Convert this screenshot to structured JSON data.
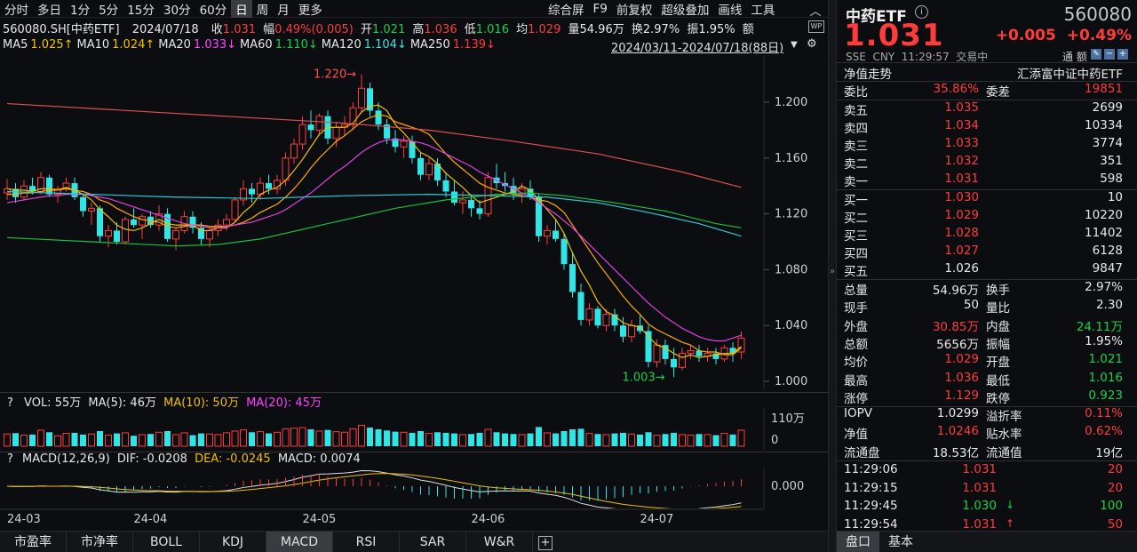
{
  "toolbar": {
    "left": [
      "分时",
      "多日",
      "1分",
      "5分",
      "15分",
      "30分",
      "60分",
      "日",
      "周",
      "月",
      "更多"
    ],
    "selected": "日",
    "right": [
      "综合屏",
      "F9",
      "前复权",
      "超级叠加",
      "画线",
      "工具"
    ],
    "collapse_icon": "chevron-up-icon"
  },
  "info": {
    "symbol": "560080.SH[中药ETF]",
    "date": "2024/07/18",
    "close_label": "收",
    "close": "1.031",
    "chg_label": "幅",
    "chg": "0.49%(0.005)",
    "open_label": "开",
    "open": "1.021",
    "high_label": "高",
    "high": "1.036",
    "low_label": "低",
    "low": "1.016",
    "avg_label": "均",
    "avg": "1.029",
    "vol_label": "量",
    "vol": "54.96万",
    "turn_label": "换",
    "turn": "2.97%",
    "amp_label": "振",
    "amp": "1.95%",
    "amt_label": "额"
  },
  "ma": [
    {
      "label": "MA5",
      "value": "1.025↑",
      "color": "#f0c000"
    },
    {
      "label": "MA10",
      "value": "1.024↑",
      "color": "#f0c000"
    },
    {
      "label": "MA20",
      "value": "1.033↓",
      "color": "#ff44ff"
    },
    {
      "label": "MA60",
      "value": "1.110↓",
      "color": "#16d24a"
    },
    {
      "label": "MA120",
      "value": "1.104↓",
      "color": "#44e0e0"
    },
    {
      "label": "MA250",
      "value": "1.139↓",
      "color": "#ff3b3b"
    }
  ],
  "range_label": "2024/03/11-2024/07/18(88日)",
  "colors": {
    "up": "#ff3b3b",
    "down": "#2ee6e6",
    "ma5": "#f0c000",
    "ma10": "#ffaa00",
    "ma20": "#e040e0",
    "ma60": "#16c040",
    "ma120": "#2ec8d8",
    "ma250": "#e05050"
  },
  "chart_data": {
    "type": "candlestick",
    "price_axis": {
      "ticks": [
        1.0,
        1.04,
        1.08,
        1.12,
        1.16,
        1.2
      ],
      "labels": [
        "1.000",
        "1.040",
        "1.080",
        "1.120",
        "1.160",
        "1.200"
      ]
    },
    "x_ticks": [
      "24-03",
      "24-04",
      "24-05",
      "24-06",
      "24-07"
    ],
    "annotations": {
      "high": "1.220",
      "low": "1.003"
    },
    "ohlc": [
      [
        1.135,
        1.145,
        1.13,
        1.138
      ],
      [
        1.138,
        1.142,
        1.128,
        1.132
      ],
      [
        1.132,
        1.144,
        1.13,
        1.14
      ],
      [
        1.14,
        1.146,
        1.134,
        1.136
      ],
      [
        1.136,
        1.15,
        1.134,
        1.146
      ],
      [
        1.146,
        1.148,
        1.132,
        1.134
      ],
      [
        1.134,
        1.14,
        1.128,
        1.138
      ],
      [
        1.138,
        1.146,
        1.136,
        1.142
      ],
      [
        1.142,
        1.146,
        1.13,
        1.132
      ],
      [
        1.132,
        1.134,
        1.118,
        1.122
      ],
      [
        1.122,
        1.128,
        1.112,
        1.124
      ],
      [
        1.124,
        1.126,
        1.1,
        1.104
      ],
      [
        1.104,
        1.112,
        1.096,
        1.108
      ],
      [
        1.108,
        1.114,
        1.098,
        1.1
      ],
      [
        1.1,
        1.118,
        1.098,
        1.116
      ],
      [
        1.116,
        1.124,
        1.11,
        1.112
      ],
      [
        1.112,
        1.12,
        1.102,
        1.118
      ],
      [
        1.118,
        1.122,
        1.11,
        1.112
      ],
      [
        1.112,
        1.126,
        1.108,
        1.12
      ],
      [
        1.12,
        1.124,
        1.1,
        1.102
      ],
      [
        1.102,
        1.11,
        1.094,
        1.108
      ],
      [
        1.108,
        1.122,
        1.106,
        1.118
      ],
      [
        1.118,
        1.122,
        1.106,
        1.11
      ],
      [
        1.11,
        1.114,
        1.098,
        1.102
      ],
      [
        1.102,
        1.11,
        1.096,
        1.108
      ],
      [
        1.108,
        1.116,
        1.104,
        1.112
      ],
      [
        1.112,
        1.12,
        1.108,
        1.116
      ],
      [
        1.116,
        1.132,
        1.114,
        1.13
      ],
      [
        1.13,
        1.144,
        1.126,
        1.138
      ],
      [
        1.138,
        1.142,
        1.128,
        1.134
      ],
      [
        1.134,
        1.146,
        1.13,
        1.142
      ],
      [
        1.142,
        1.148,
        1.134,
        1.138
      ],
      [
        1.138,
        1.148,
        1.134,
        1.144
      ],
      [
        1.144,
        1.164,
        1.14,
        1.16
      ],
      [
        1.16,
        1.174,
        1.156,
        1.17
      ],
      [
        1.17,
        1.19,
        1.166,
        1.184
      ],
      [
        1.184,
        1.194,
        1.174,
        1.18
      ],
      [
        1.18,
        1.192,
        1.176,
        1.19
      ],
      [
        1.19,
        1.194,
        1.17,
        1.174
      ],
      [
        1.174,
        1.186,
        1.168,
        1.182
      ],
      [
        1.182,
        1.19,
        1.176,
        1.184
      ],
      [
        1.184,
        1.2,
        1.18,
        1.196
      ],
      [
        1.196,
        1.22,
        1.192,
        1.21
      ],
      [
        1.21,
        1.214,
        1.19,
        1.194
      ],
      [
        1.194,
        1.2,
        1.18,
        1.184
      ],
      [
        1.184,
        1.188,
        1.17,
        1.174
      ],
      [
        1.174,
        1.18,
        1.164,
        1.168
      ],
      [
        1.168,
        1.176,
        1.16,
        1.172
      ],
      [
        1.172,
        1.176,
        1.156,
        1.16
      ],
      [
        1.16,
        1.164,
        1.144,
        1.148
      ],
      [
        1.148,
        1.16,
        1.144,
        1.156
      ],
      [
        1.156,
        1.16,
        1.14,
        1.144
      ],
      [
        1.144,
        1.15,
        1.132,
        1.136
      ],
      [
        1.136,
        1.144,
        1.126,
        1.128
      ],
      [
        1.128,
        1.136,
        1.12,
        1.13
      ],
      [
        1.13,
        1.134,
        1.118,
        1.124
      ],
      [
        1.124,
        1.13,
        1.116,
        1.12
      ],
      [
        1.12,
        1.15,
        1.118,
        1.146
      ],
      [
        1.146,
        1.156,
        1.138,
        1.142
      ],
      [
        1.142,
        1.15,
        1.136,
        1.14
      ],
      [
        1.14,
        1.146,
        1.13,
        1.134
      ],
      [
        1.134,
        1.142,
        1.128,
        1.138
      ],
      [
        1.138,
        1.144,
        1.13,
        1.132
      ],
      [
        1.132,
        1.134,
        1.1,
        1.104
      ],
      [
        1.104,
        1.112,
        1.098,
        1.108
      ],
      [
        1.108,
        1.116,
        1.1,
        1.102
      ],
      [
        1.102,
        1.106,
        1.08,
        1.084
      ],
      [
        1.084,
        1.092,
        1.06,
        1.064
      ],
      [
        1.064,
        1.07,
        1.04,
        1.044
      ],
      [
        1.044,
        1.056,
        1.04,
        1.052
      ],
      [
        1.052,
        1.054,
        1.038,
        1.04
      ],
      [
        1.04,
        1.052,
        1.036,
        1.048
      ],
      [
        1.048,
        1.052,
        1.036,
        1.04
      ],
      [
        1.04,
        1.046,
        1.028,
        1.032
      ],
      [
        1.032,
        1.044,
        1.028,
        1.04
      ],
      [
        1.04,
        1.048,
        1.034,
        1.036
      ],
      [
        1.036,
        1.04,
        1.01,
        1.014
      ],
      [
        1.014,
        1.03,
        1.01,
        1.026
      ],
      [
        1.026,
        1.03,
        1.012,
        1.016
      ],
      [
        1.016,
        1.024,
        1.003,
        1.01
      ],
      [
        1.01,
        1.024,
        1.008,
        1.02
      ],
      [
        1.02,
        1.026,
        1.016,
        1.022
      ],
      [
        1.022,
        1.026,
        1.014,
        1.018
      ],
      [
        1.018,
        1.024,
        1.014,
        1.02
      ],
      [
        1.02,
        1.024,
        1.012,
        1.016
      ],
      [
        1.016,
        1.026,
        1.014,
        1.024
      ],
      [
        1.024,
        1.028,
        1.014,
        1.02
      ],
      [
        1.021,
        1.036,
        1.016,
        1.031
      ]
    ],
    "ma_series": {
      "ma5": [
        1.138,
        1.137,
        1.137,
        1.136,
        1.138,
        1.138,
        1.137,
        1.139,
        1.137,
        1.134,
        1.13,
        1.123,
        1.118,
        1.112,
        1.109,
        1.108,
        1.11,
        1.113,
        1.116,
        1.113,
        1.112,
        1.112,
        1.112,
        1.108,
        1.108,
        1.11,
        1.11,
        1.114,
        1.121,
        1.126,
        1.134,
        1.137,
        1.139,
        1.144,
        1.151,
        1.159,
        1.168,
        1.177,
        1.182,
        1.182,
        1.182,
        1.185,
        1.193,
        1.197,
        1.198,
        1.194,
        1.184,
        1.178,
        1.171,
        1.164,
        1.161,
        1.156,
        1.149,
        1.144,
        1.139,
        1.133,
        1.128,
        1.13,
        1.132,
        1.134,
        1.136,
        1.14,
        1.137,
        1.13,
        1.123,
        1.116,
        1.106,
        1.092,
        1.079,
        1.069,
        1.057,
        1.05,
        1.047,
        1.042,
        1.04,
        1.039,
        1.032,
        1.026,
        1.024,
        1.02,
        1.017,
        1.019,
        1.017,
        1.018,
        1.019,
        1.02,
        1.02,
        1.025
      ],
      "ma10": [
        1.134,
        1.134,
        1.135,
        1.135,
        1.136,
        1.137,
        1.137,
        1.138,
        1.137,
        1.136,
        1.134,
        1.13,
        1.128,
        1.124,
        1.121,
        1.118,
        1.116,
        1.115,
        1.114,
        1.111,
        1.11,
        1.111,
        1.112,
        1.112,
        1.111,
        1.111,
        1.111,
        1.112,
        1.114,
        1.117,
        1.121,
        1.124,
        1.127,
        1.132,
        1.138,
        1.145,
        1.153,
        1.16,
        1.166,
        1.172,
        1.176,
        1.181,
        1.186,
        1.189,
        1.191,
        1.19,
        1.186,
        1.184,
        1.182,
        1.18,
        1.177,
        1.17,
        1.163,
        1.157,
        1.152,
        1.147,
        1.142,
        1.139,
        1.137,
        1.135,
        1.134,
        1.133,
        1.132,
        1.13,
        1.129,
        1.126,
        1.121,
        1.112,
        1.103,
        1.094,
        1.085,
        1.077,
        1.069,
        1.061,
        1.054,
        1.048,
        1.041,
        1.037,
        1.034,
        1.031,
        1.028,
        1.026,
        1.022,
        1.021,
        1.021,
        1.019,
        1.019,
        1.024
      ],
      "ma20": [
        1.128,
        1.129,
        1.13,
        1.131,
        1.132,
        1.133,
        1.133,
        1.134,
        1.134,
        1.134,
        1.133,
        1.132,
        1.131,
        1.129,
        1.127,
        1.125,
        1.123,
        1.121,
        1.119,
        1.117,
        1.115,
        1.113,
        1.112,
        1.111,
        1.11,
        1.11,
        1.111,
        1.112,
        1.113,
        1.114,
        1.116,
        1.118,
        1.12,
        1.123,
        1.127,
        1.131,
        1.135,
        1.14,
        1.145,
        1.15,
        1.154,
        1.159,
        1.164,
        1.168,
        1.171,
        1.173,
        1.173,
        1.173,
        1.172,
        1.171,
        1.169,
        1.166,
        1.163,
        1.16,
        1.157,
        1.154,
        1.15,
        1.147,
        1.144,
        1.141,
        1.138,
        1.135,
        1.132,
        1.128,
        1.124,
        1.12,
        1.115,
        1.11,
        1.104,
        1.098,
        1.092,
        1.086,
        1.08,
        1.074,
        1.068,
        1.062,
        1.056,
        1.051,
        1.046,
        1.042,
        1.038,
        1.035,
        1.032,
        1.03,
        1.029,
        1.029,
        1.031,
        1.033
      ]
    },
    "ma_long": {
      "ma60": [
        [
          0,
          1.103
        ],
        [
          10,
          1.1
        ],
        [
          20,
          1.097
        ],
        [
          25,
          1.098
        ],
        [
          30,
          1.102
        ],
        [
          38,
          1.113
        ],
        [
          46,
          1.124
        ],
        [
          52,
          1.13
        ],
        [
          58,
          1.134
        ],
        [
          62,
          1.135
        ],
        [
          66,
          1.133
        ],
        [
          72,
          1.128
        ],
        [
          78,
          1.122
        ],
        [
          84,
          1.113
        ],
        [
          87,
          1.11
        ]
      ],
      "ma120": [
        [
          0,
          1.136
        ],
        [
          10,
          1.134
        ],
        [
          20,
          1.132
        ],
        [
          30,
          1.131
        ],
        [
          40,
          1.133
        ],
        [
          50,
          1.134
        ],
        [
          58,
          1.133
        ],
        [
          64,
          1.132
        ],
        [
          70,
          1.128
        ],
        [
          76,
          1.121
        ],
        [
          82,
          1.113
        ],
        [
          87,
          1.104
        ]
      ],
      "ma250": [
        [
          0,
          1.199
        ],
        [
          20,
          1.192
        ],
        [
          40,
          1.185
        ],
        [
          50,
          1.18
        ],
        [
          60,
          1.172
        ],
        [
          70,
          1.163
        ],
        [
          80,
          1.15
        ],
        [
          87,
          1.139
        ]
      ]
    },
    "volume": {
      "title": "VOL: 55万",
      "ma5_label": "MA(5): 46万",
      "ma10_label": "MA(10): 50万",
      "ma20_label": "MA(20): 45万",
      "axis_ticks": [
        "110万",
        "0"
      ],
      "values": [
        42,
        45,
        38,
        40,
        55,
        48,
        36,
        44,
        46,
        40,
        42,
        52,
        38,
        44,
        46,
        36,
        40,
        42,
        48,
        52,
        40,
        46,
        38,
        44,
        42,
        40,
        46,
        52,
        56,
        48,
        50,
        44,
        48,
        60,
        62,
        64,
        58,
        52,
        56,
        50,
        48,
        60,
        72,
        64,
        58,
        54,
        50,
        48,
        46,
        52,
        44,
        48,
        46,
        44,
        40,
        42,
        46,
        58,
        48,
        44,
        42,
        40,
        44,
        66,
        46,
        44,
        52,
        58,
        60,
        44,
        42,
        40,
        44,
        46,
        42,
        40,
        48,
        38,
        42,
        46,
        40,
        38,
        42,
        40,
        38,
        44,
        40,
        55
      ]
    },
    "macd": {
      "label": "MACD(12,26,9)",
      "dif_label": "DIF: -0.0208",
      "dea_label": "DEA: -0.0245",
      "macd_label": "MACD: 0.0074",
      "axis_tick": "0.000"
    }
  },
  "bottom_tabs": [
    "市盈率",
    "市净率",
    "BOLL",
    "KDJ",
    "MACD",
    "RSI",
    "SAR",
    "W&R"
  ],
  "bottom_selected": "MACD",
  "add_tab_icon": "plus-icon",
  "quote": {
    "name": "中药ETF",
    "code": "560080",
    "price": "1.031",
    "change": "+0.005",
    "pct": "+0.49%",
    "meta": "SSE  CNY  11:29:57  交易中",
    "nav_label": "净值走势",
    "fund_name": "汇添富中证中药ETF",
    "wb_label": "委比",
    "wb": "35.86%",
    "wc_label": "委差",
    "wc": "19851",
    "asks": [
      {
        "label": "卖五",
        "price": "1.035",
        "vol": "2699"
      },
      {
        "label": "卖四",
        "price": "1.034",
        "vol": "10334"
      },
      {
        "label": "卖三",
        "price": "1.033",
        "vol": "3774"
      },
      {
        "label": "卖二",
        "price": "1.032",
        "vol": "351"
      },
      {
        "label": "卖一",
        "price": "1.031",
        "vol": "598"
      }
    ],
    "bids": [
      {
        "label": "买一",
        "price": "1.030",
        "vol": "10"
      },
      {
        "label": "买二",
        "price": "1.029",
        "vol": "10220"
      },
      {
        "label": "买三",
        "price": "1.028",
        "vol": "11402"
      },
      {
        "label": "买四",
        "price": "1.027",
        "vol": "6128"
      },
      {
        "label": "买五",
        "price": "1.026",
        "vol": "9847"
      }
    ],
    "stats": [
      {
        "l1": "总量",
        "v1": "54.96万",
        "c1": "w",
        "l2": "换手",
        "v2": "2.97%",
        "c2": "w"
      },
      {
        "l1": "现手",
        "v1": "50",
        "c1": "w",
        "l2": "量比",
        "v2": "2.30",
        "c2": "w"
      },
      {
        "l1": "外盘",
        "v1": "30.85万",
        "c1": "r",
        "l2": "内盘",
        "v2": "24.11万",
        "c2": "g"
      },
      {
        "l1": "总额",
        "v1": "5656万",
        "c1": "w",
        "l2": "振幅",
        "v2": "1.95%",
        "c2": "w"
      },
      {
        "l1": "均价",
        "v1": "1.029",
        "c1": "r",
        "l2": "开盘",
        "v2": "1.021",
        "c2": "g"
      },
      {
        "l1": "最高",
        "v1": "1.036",
        "c1": "r",
        "l2": "最低",
        "v2": "1.016",
        "c2": "g"
      },
      {
        "l1": "涨停",
        "v1": "1.129",
        "c1": "r",
        "l2": "跌停",
        "v2": "0.923",
        "c2": "g"
      }
    ],
    "stats2": [
      {
        "l1": "IOPV",
        "v1": "1.0299",
        "c1": "w",
        "l2": "溢折率",
        "v2": "0.11%",
        "c2": "r"
      },
      {
        "l1": "净值",
        "v1": "1.0246",
        "c1": "r",
        "l2": "贴水率",
        "v2": "0.62%",
        "c2": "r"
      },
      {
        "l1": "流通盘",
        "v1": "18.53亿",
        "c1": "w",
        "l2": "流通值",
        "v2": "19亿",
        "c2": "w"
      }
    ],
    "ticks": [
      {
        "time": "11:29:06",
        "price": "1.031",
        "arrow": "",
        "vol": "20",
        "c": "r"
      },
      {
        "time": "11:29:15",
        "price": "1.031",
        "arrow": "",
        "vol": "20",
        "c": "r"
      },
      {
        "time": "11:29:45",
        "price": "1.030",
        "arrow": "↓",
        "vol": "100",
        "c": "g"
      },
      {
        "time": "11:29:54",
        "price": "1.031",
        "arrow": "↑",
        "vol": "50",
        "c": "r"
      }
    ],
    "tabs": [
      "盘口",
      "基本"
    ],
    "tab_selected": "盘口",
    "tool_label": "通 额"
  }
}
